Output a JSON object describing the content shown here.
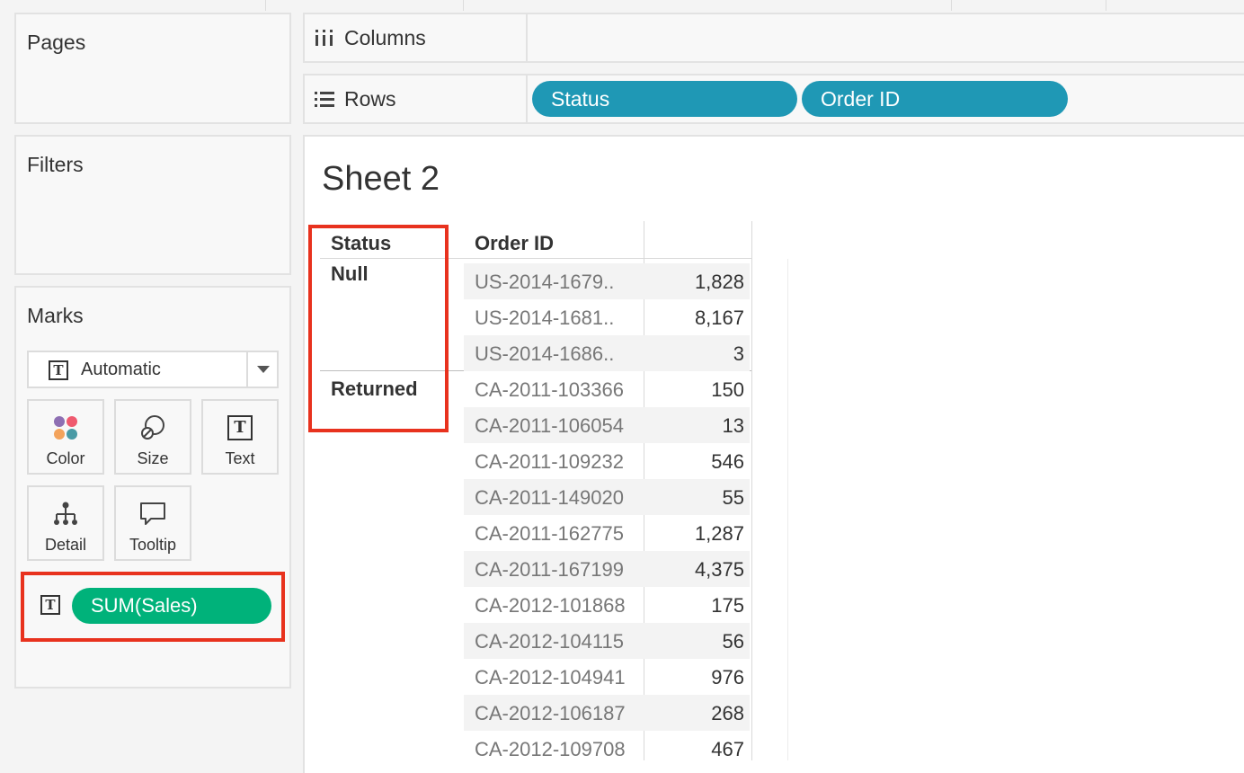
{
  "left_panel": {
    "pages_title": "Pages",
    "filters_title": "Filters",
    "marks_title": "Marks",
    "mark_type": "Automatic",
    "mark_buttons": [
      {
        "label": "Color",
        "icon": "color-dots-icon"
      },
      {
        "label": "Size",
        "icon": "size-circles-icon"
      },
      {
        "label": "Text",
        "icon": "text-box-icon"
      },
      {
        "label": "Detail",
        "icon": "detail-tree-icon"
      },
      {
        "label": "Tooltip",
        "icon": "speech-bubble-icon"
      }
    ],
    "text_field_pill": "SUM(Sales)"
  },
  "shelves": {
    "columns_label": "Columns",
    "rows_label": "Rows",
    "row_pills": [
      "Status",
      "Order ID"
    ]
  },
  "view": {
    "sheet_title": "Sheet 2",
    "headers": {
      "status": "Status",
      "order_id": "Order ID"
    },
    "groups": [
      {
        "status": "Null",
        "rows": [
          {
            "order_id": "US-2014-1679..",
            "value": "1,828"
          },
          {
            "order_id": "US-2014-1681..",
            "value": "8,167"
          },
          {
            "order_id": "US-2014-1686..",
            "value": "3"
          }
        ]
      },
      {
        "status": "Returned",
        "rows": [
          {
            "order_id": "CA-2011-103366",
            "value": "150"
          },
          {
            "order_id": "CA-2011-106054",
            "value": "13"
          },
          {
            "order_id": "CA-2011-109232",
            "value": "546"
          },
          {
            "order_id": "CA-2011-149020",
            "value": "55"
          },
          {
            "order_id": "CA-2011-162775",
            "value": "1,287"
          },
          {
            "order_id": "CA-2011-167199",
            "value": "4,375"
          },
          {
            "order_id": "CA-2012-101868",
            "value": "175"
          },
          {
            "order_id": "CA-2012-104115",
            "value": "56"
          },
          {
            "order_id": "CA-2012-104941",
            "value": "976"
          },
          {
            "order_id": "CA-2012-106187",
            "value": "268"
          },
          {
            "order_id": "CA-2012-109708",
            "value": "467"
          }
        ]
      }
    ]
  },
  "colors": {
    "dimension_pill": "#1f98b5",
    "measure_pill": "#00b27a",
    "highlight_box": "#e8321e"
  }
}
